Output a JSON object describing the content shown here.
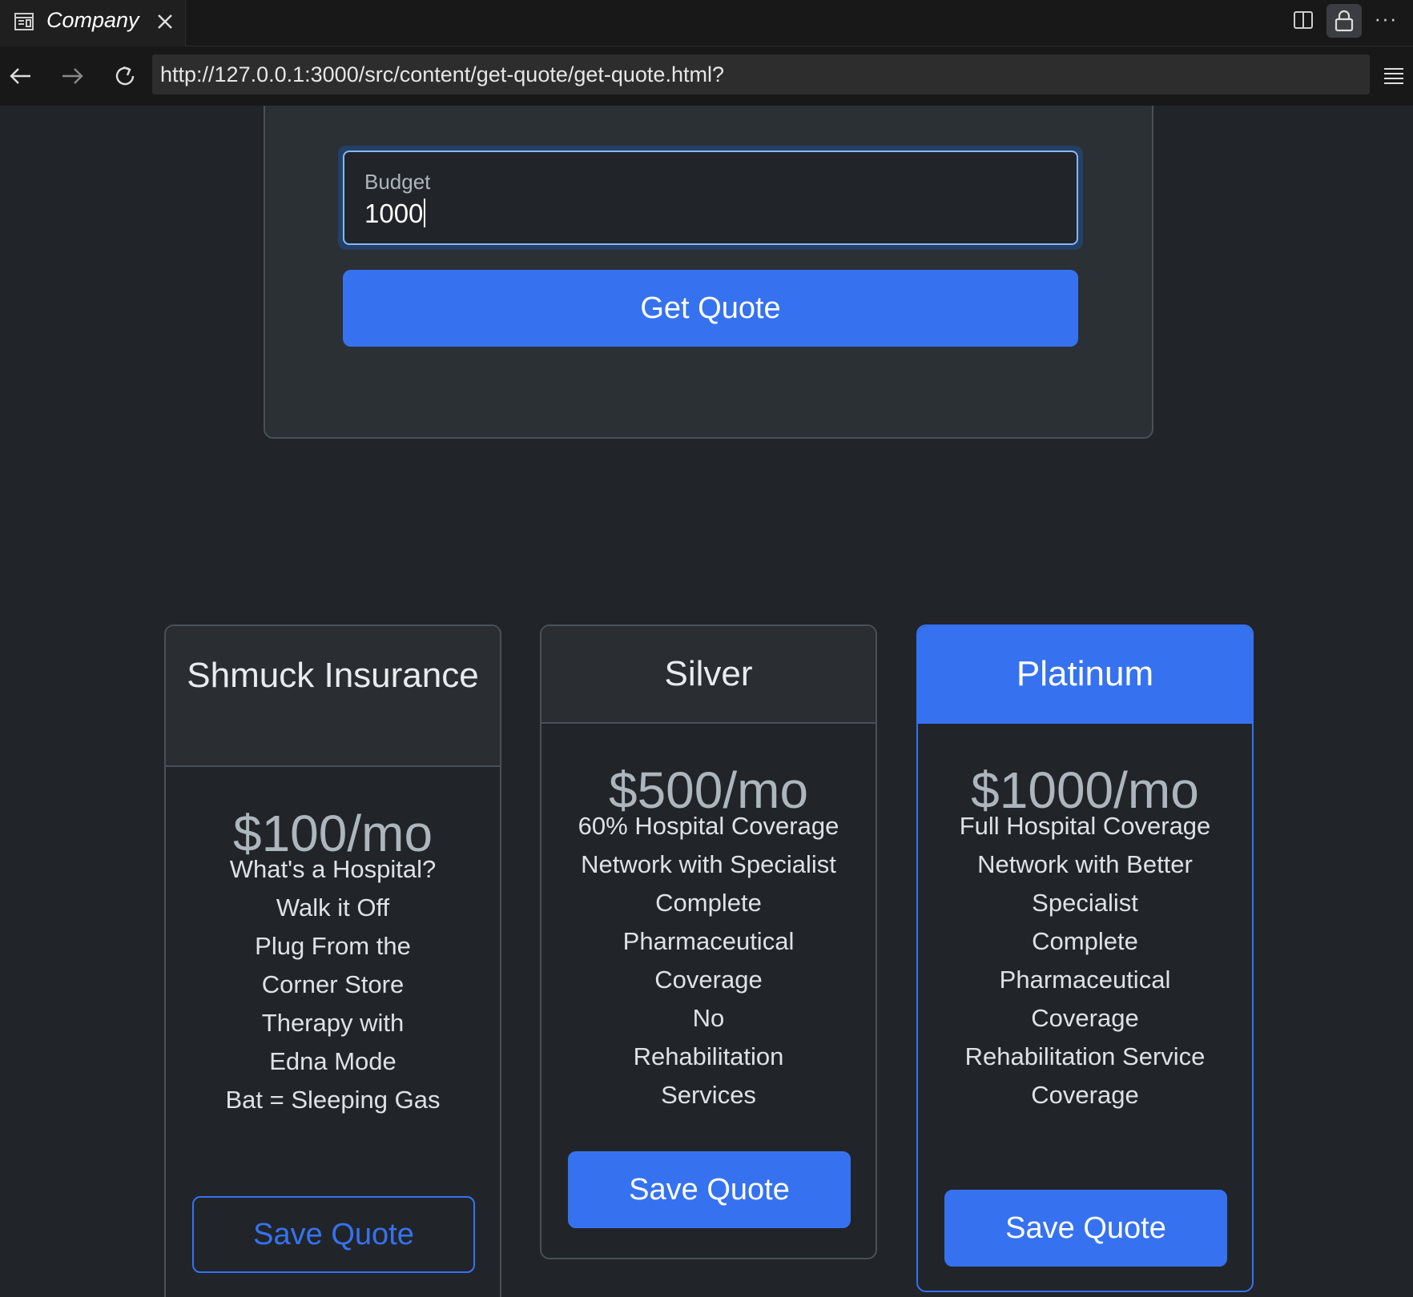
{
  "browser": {
    "tab_title": "Company",
    "url": "http://127.0.0.1:3000/src/content/get-quote/get-quote.html?",
    "icons": [
      "page-icon",
      "close-icon",
      "split-view-icon",
      "lock-icon",
      "more-icon",
      "back-icon",
      "forward-icon",
      "reload-icon",
      "menu-icon"
    ]
  },
  "form": {
    "budget_label": "Budget",
    "budget_value": "1000",
    "submit_label": "Get Quote"
  },
  "plans": [
    {
      "name": "Shmuck Insurance",
      "price": "$100/mo",
      "features": [
        "What's a Hospital?",
        "Walk it Off",
        "Plug From the Corner Store",
        "Therapy with Edna Mode",
        "Bat = Sleeping Gas"
      ],
      "button": "Save Quote"
    },
    {
      "name": "Silver",
      "price": "$500/mo",
      "features": [
        "60% Hospital Coverage",
        "Network with Specialist",
        "Complete Pharmaceutical Coverage",
        "No Rehabilitation Services"
      ],
      "button": "Save Quote"
    },
    {
      "name": "Platinum",
      "price": "$1000/mo",
      "features": [
        "Full Hospital Coverage",
        "Network with Better Specialist",
        "Complete Pharmaceutical Coverage",
        "Rehabilitation Service Coverage"
      ],
      "button": "Save Quote"
    }
  ],
  "colors": {
    "accent": "#3672f0",
    "page_bg": "#212529",
    "card_bg": "#2b3035"
  }
}
